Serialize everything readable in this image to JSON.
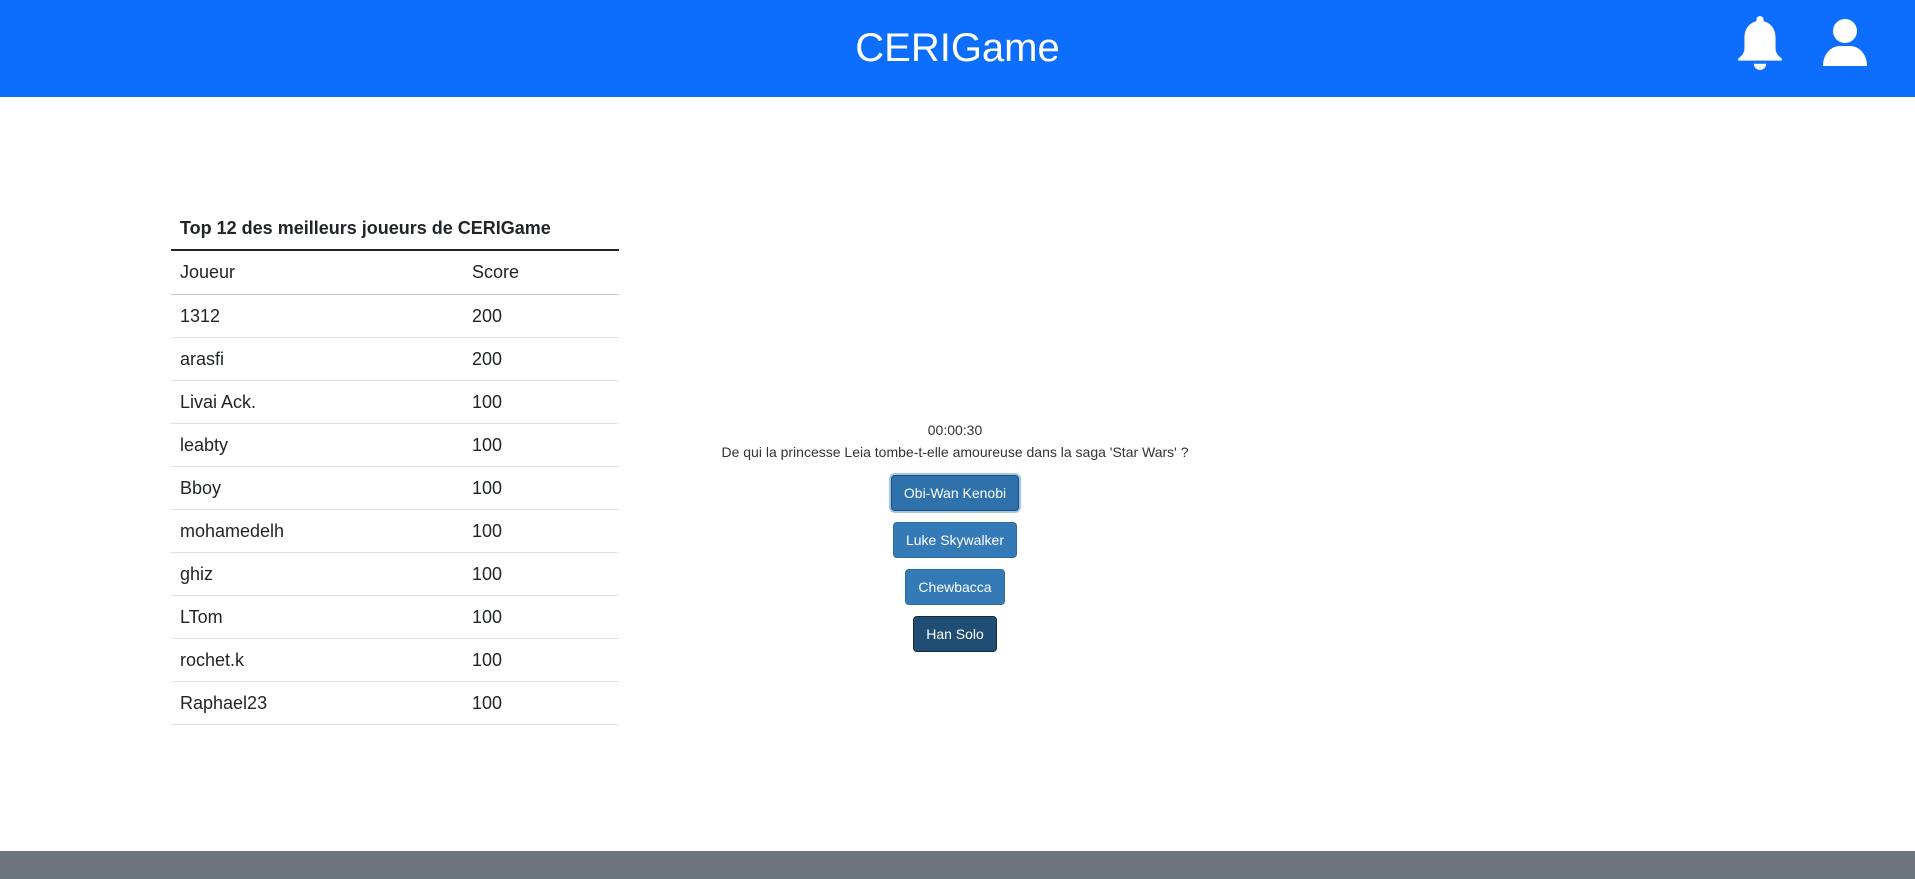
{
  "header": {
    "title": "CERIGame",
    "icons": [
      "bell-icon",
      "user-icon"
    ],
    "background_color": "#0d6efd"
  },
  "leaderboard": {
    "caption": "Top 12 des meilleurs joueurs de CERIGame",
    "columns": [
      "Joueur",
      "Score"
    ],
    "rows": [
      {
        "player": "1312",
        "score": "200"
      },
      {
        "player": "arasfi",
        "score": "200"
      },
      {
        "player": "Livai Ack.",
        "score": "100"
      },
      {
        "player": "leabty",
        "score": "100"
      },
      {
        "player": "Bboy",
        "score": "100"
      },
      {
        "player": "mohamedelh",
        "score": "100"
      },
      {
        "player": "ghiz",
        "score": "100"
      },
      {
        "player": "LTom",
        "score": "100"
      },
      {
        "player": "rochet.k",
        "score": "100"
      },
      {
        "player": "Raphael23",
        "score": "100"
      }
    ]
  },
  "quiz": {
    "timer": "00:00:30",
    "question": "De qui la princesse Leia tombe-t-elle amoureuse dans la saga 'Star Wars' ?",
    "answers": [
      "Obi-Wan Kenobi",
      "Luke Skywalker",
      "Chewbacca",
      "Han Solo"
    ],
    "button_color": "#337ab7"
  },
  "footer": {
    "background_color": "#6c757d"
  }
}
